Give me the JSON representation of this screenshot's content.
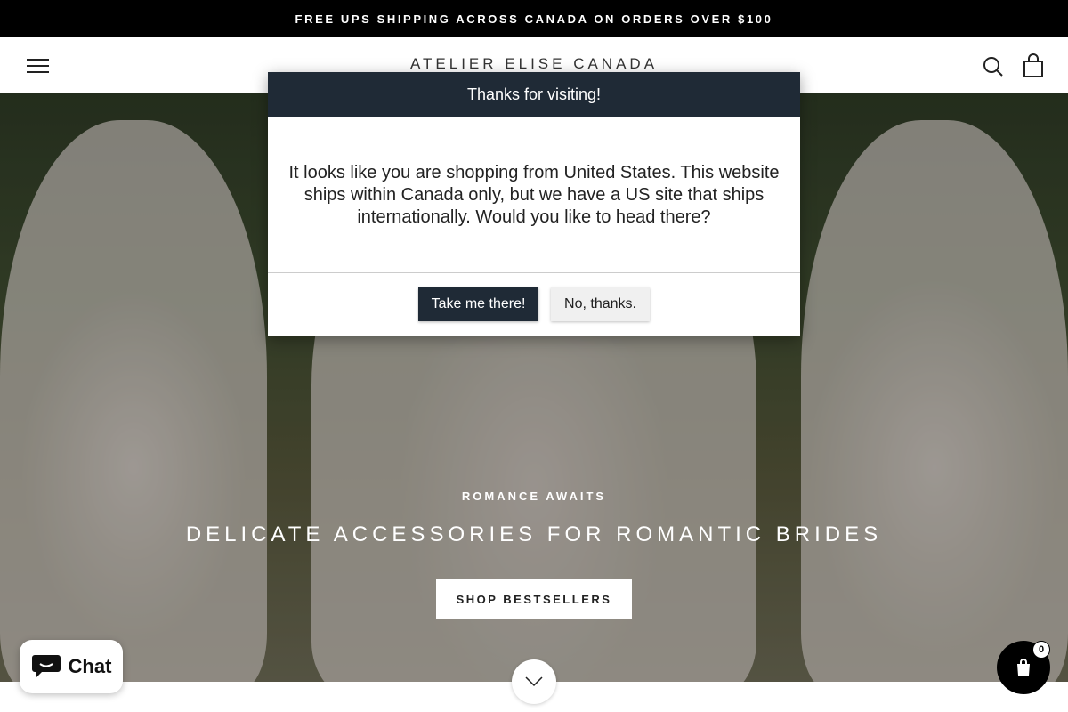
{
  "announcement": {
    "text": "FREE UPS SHIPPING ACROSS CANADA ON ORDERS OVER $100"
  },
  "header": {
    "brand": "ATELIER ELISE CANADA",
    "icons": {
      "menu": "hamburger-menu-icon",
      "search": "search-icon",
      "cart": "shopping-bag-icon"
    }
  },
  "hero": {
    "subtitle": "ROMANCE AWAITS",
    "title": "DELICATE ACCESSORIES FOR ROMANTIC BRIDES",
    "cta": "SHOP BESTSELLERS"
  },
  "modal": {
    "title": "Thanks for visiting!",
    "message": "It looks like you are shopping from United States. This website ships within Canada only, but we have a US site that ships internationally. Would you like to head there?",
    "confirm": "Take me there!",
    "decline": "No, thanks."
  },
  "chat": {
    "label": "Chat"
  },
  "cart": {
    "count": "0"
  },
  "colors": {
    "modal_header": "#1f2a36",
    "announcement_bg": "#000000",
    "chat_accent": "#111111"
  }
}
